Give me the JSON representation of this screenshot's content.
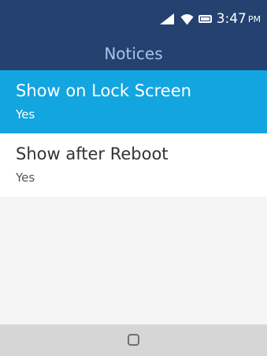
{
  "status_bar": {
    "time": "3:47",
    "ampm": "PM",
    "icons": [
      "signal-icon",
      "wifi-icon",
      "battery-icon"
    ]
  },
  "header": {
    "title": "Notices"
  },
  "settings": [
    {
      "label": "Show on Lock Screen",
      "value": "Yes",
      "selected": true
    },
    {
      "label": "Show after Reboot",
      "value": "Yes",
      "selected": false
    }
  ],
  "nav": {
    "home_icon": "home-circle-icon"
  },
  "colors": {
    "header_bg": "#24416f",
    "header_text": "#a6c5e8",
    "selected_bg": "#13a5e0",
    "nav_bg": "#d6d6d6",
    "body_bg": "#f5f5f5"
  }
}
